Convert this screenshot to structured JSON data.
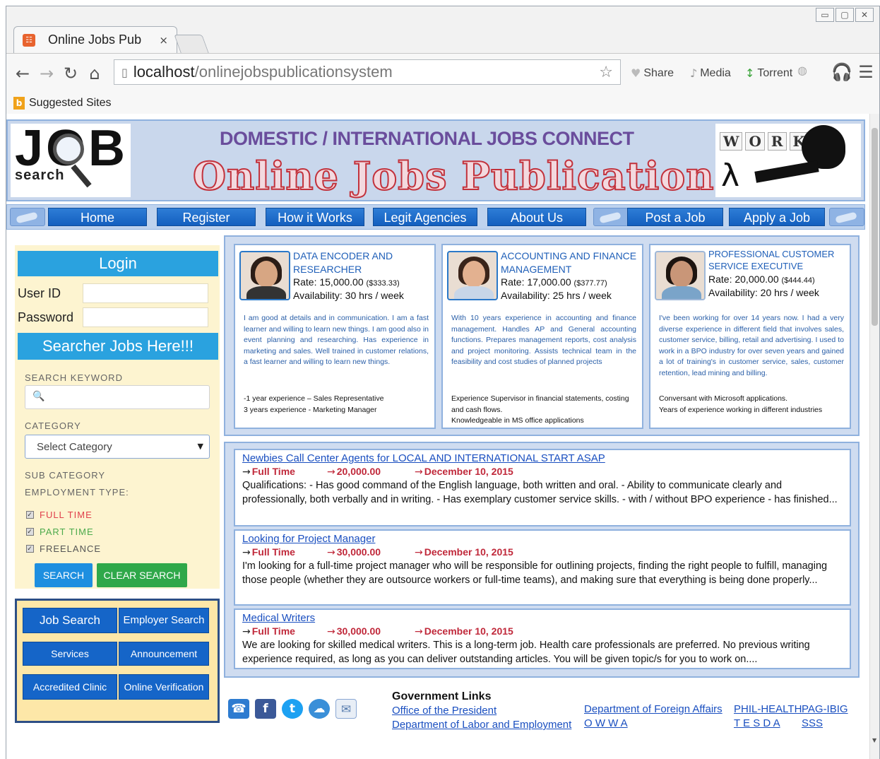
{
  "browser": {
    "tab_title": "Online Jobs Pub",
    "tab_close": "×",
    "url_host": "localhost",
    "url_path": "/onlinejobspublicationsystem",
    "extensions": [
      {
        "icon": "heart-icon",
        "label": "Share"
      },
      {
        "icon": "media-icon",
        "label": "Media"
      },
      {
        "icon": "torrent-icon",
        "label": "Torrent"
      }
    ],
    "bookmark": "Suggested Sites",
    "window_controls": [
      "minimize",
      "maximize",
      "close"
    ]
  },
  "banner": {
    "logo_big": "JOB",
    "logo_sub": "search",
    "tagline": "DOMESTIC / INTERNATIONAL  JOBS CONNECT",
    "title": "Online Jobs Publication",
    "work_letters": [
      "W",
      "O",
      "R",
      "K"
    ]
  },
  "nav": [
    "Home",
    "Register",
    "How it Works",
    "Legit Agencies",
    "About Us",
    "Post a Job",
    "Apply a Job"
  ],
  "login": {
    "heading": "Login",
    "user_label": "User ID",
    "password_label": "Password"
  },
  "search": {
    "heading": "Searcher Jobs Here!!!",
    "keyword_label": "SEARCH KEYWORD",
    "category_label": "CATEGORY",
    "category_value": "Select Category",
    "subcategory_label": "SUB CATEGORY",
    "employment_label": "EMPLOYMENT TYPE:",
    "types": [
      {
        "label": "FULL TIME",
        "color": "#e0404c"
      },
      {
        "label": "PART TIME",
        "color": "#4caa4c"
      },
      {
        "label": "FREELANCE",
        "color": "#555555"
      }
    ],
    "search_button": "SEARCH",
    "clear_button": "CLEAR SEARCH"
  },
  "quicklinks": [
    "Job Search",
    "Employer Search",
    "Services",
    "Announcement",
    "Accredited Clinic",
    "Online Verification"
  ],
  "profiles": [
    {
      "role": "DATA ENCODER AND RESEARCHER",
      "rate": "Rate: 15,000.00",
      "rate_usd": "($333.33)",
      "availability": "Availability: 30 hrs / week",
      "description": "I am good at details and in communication. I am a fast learner and willing to learn new things. I am good also in event planning and researching. Has experience in marketing and sales. Well trained in customer relations, a fast learner and willing to learn new things.",
      "experience": [
        "-1 year experience – Sales Representative",
        "3 years experience - Marketing Manager"
      ]
    },
    {
      "role": "ACCOUNTING AND FINANCE MANAGEMENT",
      "rate": "Rate: 17,000.00",
      "rate_usd": "($377.77)",
      "availability": "Availability: 25 hrs / week",
      "description": "With 10 years experience in accounting and finance management. Handles AP and General accounting functions. Prepares management reports, cost analysis and project monitoring. Assists technical team in the feasibility and cost studies of planned projects",
      "experience": [
        "Experience Supervisor in financial statements, costing and cash flows.",
        "Knowledgeable in MS office applications"
      ]
    },
    {
      "role": "PROFESSIONAL CUSTOMER SERVICE EXECUTIVE",
      "rate": "Rate: 20,000.00",
      "rate_usd": "($444.44)",
      "availability": "Availability: 20 hrs / week",
      "description": "I've been working for over 14 years now. I had a very diverse experience in different field that involves sales, customer service, billing, retail and advertising. I used to work in a BPO industry for over seven years and gained a lot of training's in customer service, sales, customer retention, lead mining and billing.",
      "experience": [
        "Conversant with Microsoft applications.",
        "Years of experience working in different industries"
      ]
    }
  ],
  "jobs": [
    {
      "title": "Newbies Call Center Agents for LOCAL AND INTERNATIONAL START ASAP",
      "type": "Full Time",
      "salary": "20,000.00",
      "date": "December 10, 2015",
      "description": "Qualifications: - Has good command of the English language, both written and oral. - Ability to communicate clearly and professionally, both verbally and in writing. - Has exemplary customer service skills. - with / without BPO experience - has finished..."
    },
    {
      "title": "Looking for Project Manager",
      "type": "Full Time",
      "salary": "30,000.00",
      "date": "December 10, 2015",
      "description": "I'm looking for a full-time project manager who will be responsible for outlining projects, finding the right people to fulfill, managing those people (whether they are outsource workers or full-time teams), and making sure that everything is being done properly..."
    },
    {
      "title": "Medical Writers",
      "type": "Full Time",
      "salary": "30,000.00",
      "date": "December 10, 2015",
      "description": "We are looking for skilled medical writers. This is a long-term job. Health care professionals are preferred. No previous writing experience required, as long as you can deliver outstanding articles. You will be given topic/s for you to work on...."
    }
  ],
  "footer": {
    "social": [
      "phone-icon",
      "facebook-icon",
      "twitter-icon",
      "chat-icon",
      "mail-icon"
    ],
    "gov_heading": "Government Links",
    "links": [
      "Office of the President",
      "Department of Labor and Employment",
      "Department of Foreign Affairs",
      "O W W A",
      "PHIL-HEALTH",
      "T E S D A",
      "PAG-IBIG",
      "SSS"
    ]
  }
}
